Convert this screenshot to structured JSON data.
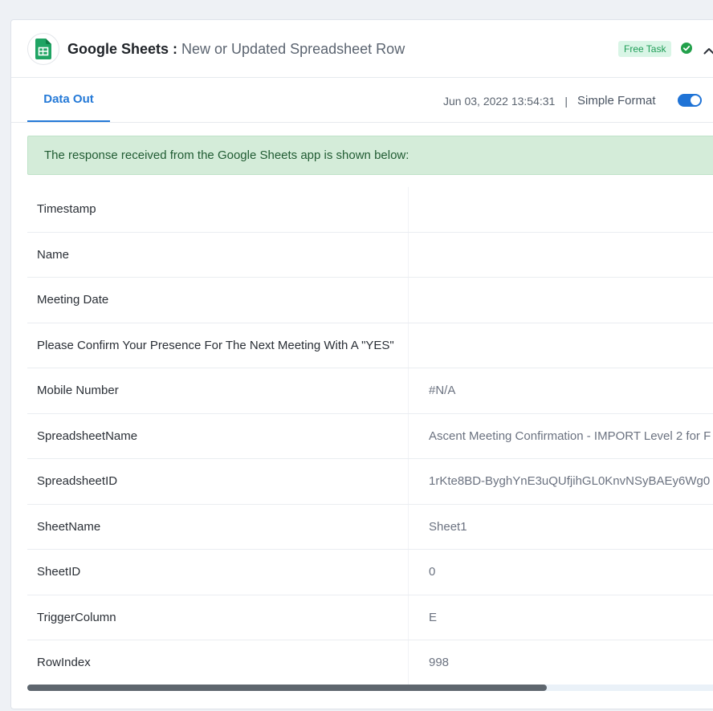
{
  "header": {
    "app_name": "Google Sheets",
    "separator": " : ",
    "event_name": "New or Updated Spreadsheet Row",
    "badge": "Free Task"
  },
  "icons": {
    "logo": "google-sheets-icon",
    "status": "check-circle-icon",
    "collapse": "chevron-up-icon"
  },
  "tabs": [
    {
      "label": "Data Out",
      "active": true
    }
  ],
  "meta": {
    "timestamp": "Jun 03, 2022 13:54:31",
    "separator": "|",
    "format_label": "Simple Format",
    "simple_format_on": true
  },
  "notice": "The response received from the Google Sheets app is shown below:",
  "rows": [
    {
      "key": "Timestamp",
      "value": ""
    },
    {
      "key": "Name",
      "value": ""
    },
    {
      "key": "Meeting Date",
      "value": ""
    },
    {
      "key": "Please Confirm Your Presence For The Next Meeting With A \"YES\"",
      "value": ""
    },
    {
      "key": "Mobile Number",
      "value": "#N/A"
    },
    {
      "key": "SpreadsheetName",
      "value": "Ascent Meeting Confirmation - IMPORT Level 2 for F"
    },
    {
      "key": "SpreadsheetID",
      "value": "1rKte8BD-ByghYnE3uQUfjihGL0KnvNSyBAEy6Wg0"
    },
    {
      "key": "SheetName",
      "value": "Sheet1"
    },
    {
      "key": "SheetID",
      "value": "0"
    },
    {
      "key": "TriggerColumn",
      "value": "E"
    },
    {
      "key": "RowIndex",
      "value": "998"
    }
  ],
  "colors": {
    "accent": "#2479d7",
    "badge_bg": "#d9f5e6",
    "badge_text": "#1f9d57",
    "notice_bg": "#d4ecd9",
    "notice_text": "#215c33",
    "success": "#22a04b",
    "sheets_green": "#1fa463"
  }
}
